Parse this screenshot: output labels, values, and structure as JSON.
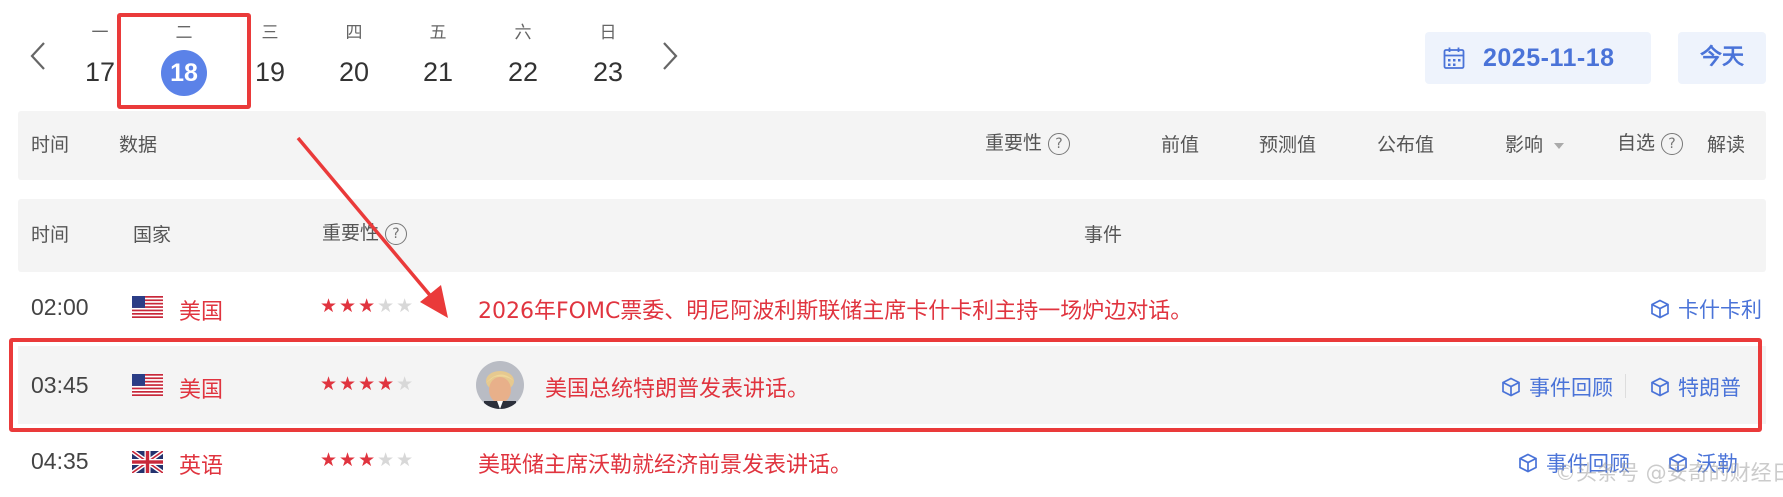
{
  "date_bar": {
    "prev_arrow": "‹",
    "next_arrow": "›",
    "days": [
      {
        "weekday": "一",
        "day": "17"
      },
      {
        "weekday": "二",
        "day": "18"
      },
      {
        "weekday": "三",
        "day": "19"
      },
      {
        "weekday": "四",
        "day": "20"
      },
      {
        "weekday": "五",
        "day": "21"
      },
      {
        "weekday": "六",
        "day": "22"
      },
      {
        "weekday": "日",
        "day": "23"
      }
    ],
    "selected_date": "2025-11-18",
    "today_label": "今天"
  },
  "data_header": {
    "time": "时间",
    "data": "数据",
    "importance": "重要性",
    "previous": "前值",
    "forecast": "预测值",
    "actual": "公布值",
    "impact": "影响",
    "watchlist": "自选",
    "interpretation": "解读"
  },
  "event_header": {
    "time": "时间",
    "country": "国家",
    "importance": "重要性",
    "event": "事件"
  },
  "events": [
    {
      "time": "02:00",
      "country": "美国",
      "stars": 3,
      "event": "2026年FOMC票委、明尼阿波利斯联储主席卡什卡利主持一场炉边对话。",
      "links": [
        "卡什卡利"
      ]
    },
    {
      "time": "03:45",
      "country": "美国",
      "stars": 4,
      "event": "美国总统特朗普发表讲话。",
      "links": [
        "事件回顾",
        "特朗普"
      ]
    },
    {
      "time": "04:35",
      "country": "英语",
      "stars": 3,
      "event": "美联储主席沃勒就经济前景发表讲话。",
      "links": [
        "事件回顾",
        "沃勒"
      ]
    }
  ],
  "watermark": "©头条号 @安奇的财经日记",
  "colors": {
    "accent_blue": "#4a73d8",
    "selected_day": "#5b82e8",
    "event_red": "#e0343f",
    "highlight_red": "#ea3a3a"
  }
}
